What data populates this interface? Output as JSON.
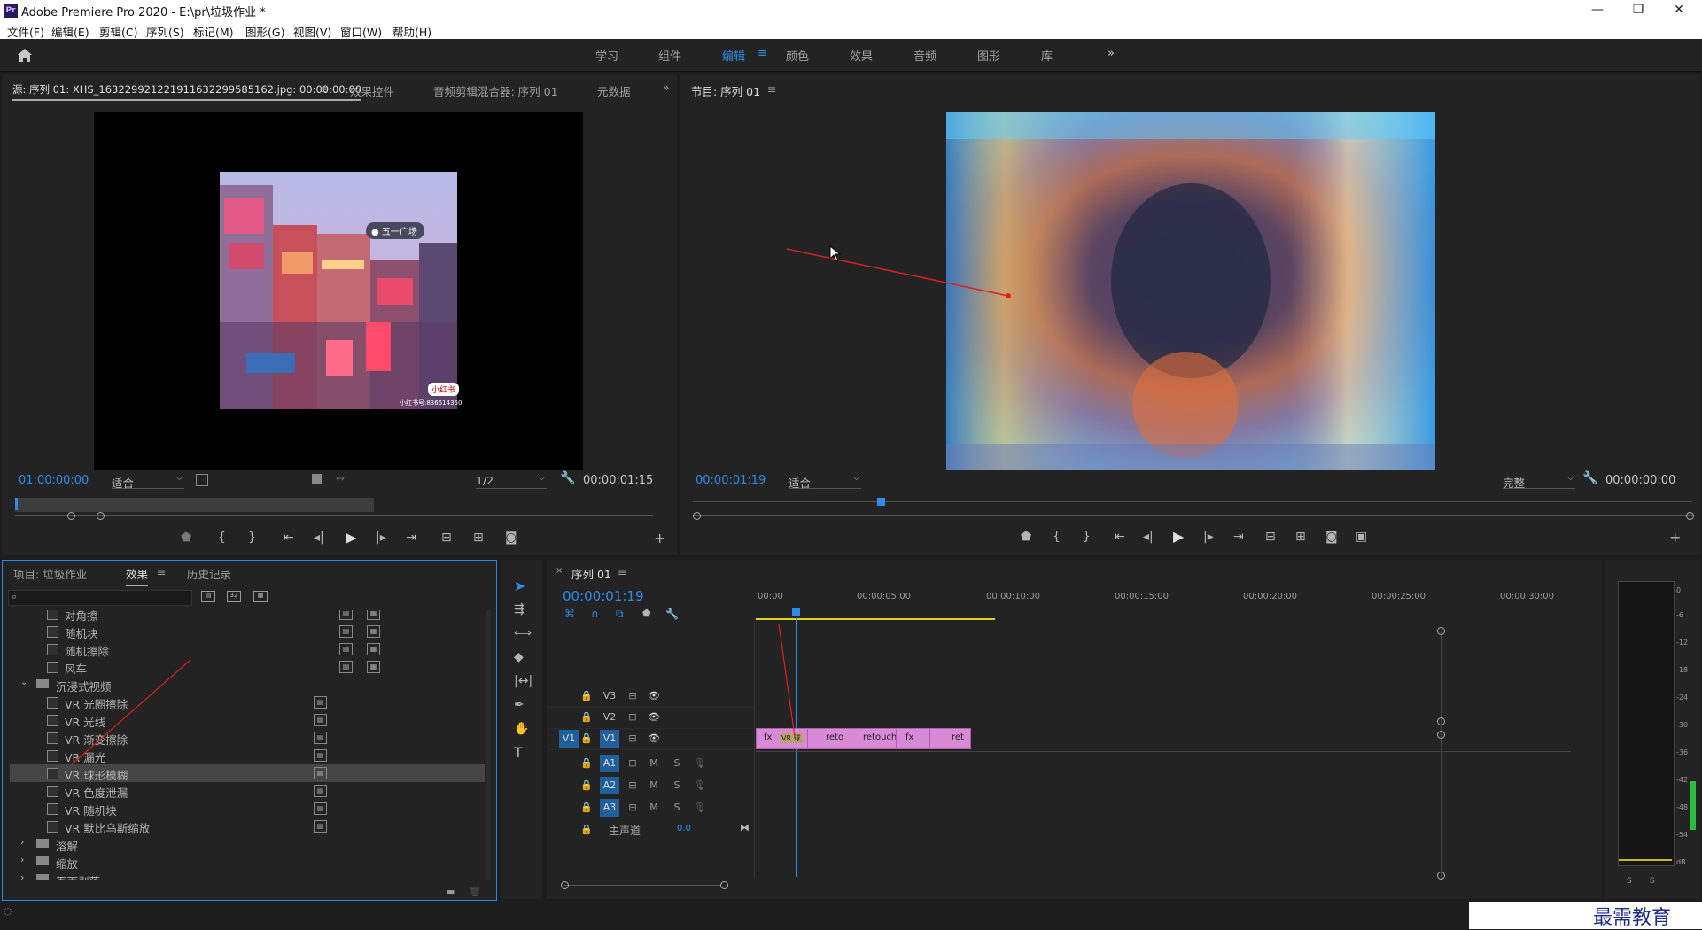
{
  "window": {
    "title": "Adobe Premiere Pro 2020 - E:\\pr\\垃圾作业 *",
    "logo": "Pr",
    "minimize": "—",
    "restore": "❐",
    "close": "✕"
  },
  "menu": [
    "文件(F)",
    "编辑(E)",
    "剪辑(C)",
    "序列(S)",
    "标记(M)",
    "图形(G)",
    "视图(V)",
    "窗口(W)",
    "帮助(H)"
  ],
  "workspaces": [
    "学习",
    "组件",
    "编辑",
    "颜色",
    "效果",
    "音频",
    "图形",
    "库"
  ],
  "workspace_more": "»",
  "source_panel": {
    "tabs": [
      "源: 序列 01: XHS_16322992122191163229958516​2.jpg: 00:00:00:00",
      "效果控件",
      "音频剪辑混合器: 序列 01",
      "元数据"
    ],
    "timecode": "01:00:00:00",
    "fit": "适合",
    "resolution": "1/2",
    "duration": "00:00:01:15",
    "image_sign": "五一广场",
    "image_badge": "小红书",
    "image_footer": "小红书号:836514360"
  },
  "program_panel": {
    "tab": "节目: 序列 01",
    "timecode": "00:00:01:19",
    "fit": "适合",
    "quality": "完整",
    "duration": "00:00:00:00"
  },
  "project_panel": {
    "tabs": [
      "项目: 垃圾作业",
      "效果",
      "历史记录"
    ],
    "search_placeholder": "",
    "rows": [
      {
        "type": "effect",
        "label": "对角擦",
        "vr": false
      },
      {
        "type": "effect",
        "label": "随机块",
        "vr": false
      },
      {
        "type": "effect",
        "label": "随机擦除",
        "vr": false
      },
      {
        "type": "effect",
        "label": "风车",
        "vr": false
      },
      {
        "type": "folder",
        "label": "沉浸式视频",
        "open": true
      },
      {
        "type": "effect",
        "label": "VR 光圈擦除",
        "vr": true
      },
      {
        "type": "effect",
        "label": "VR 光线",
        "vr": true
      },
      {
        "type": "effect",
        "label": "VR 渐变擦除",
        "vr": true
      },
      {
        "type": "effect",
        "label": "VR 漏光",
        "vr": true
      },
      {
        "type": "effect",
        "label": "VR 球形模糊",
        "vr": true,
        "selected": true
      },
      {
        "type": "effect",
        "label": "VR 色度泄漏",
        "vr": true
      },
      {
        "type": "effect",
        "label": "VR 随机块",
        "vr": true
      },
      {
        "type": "effect",
        "label": "VR 默比乌斯缩放",
        "vr": true
      },
      {
        "type": "folder",
        "label": "溶解",
        "open": false
      },
      {
        "type": "folder",
        "label": "缩放",
        "open": false
      },
      {
        "type": "folder",
        "label": "页面剥落",
        "open": false
      }
    ]
  },
  "timeline": {
    "tab": "序列 01",
    "timecode": "00:00:01:19",
    "ruler": [
      "00:00",
      "00:00:05:00",
      "00:00:10:00",
      "00:00:15:00",
      "00:00:20:00",
      "00:00:25:00",
      "00:00:30:00"
    ],
    "video_tracks": [
      "V3",
      "V2",
      "V1"
    ],
    "audio_tracks": [
      "A1",
      "A2",
      "A3"
    ],
    "source_patch": "V1",
    "master": "主声道",
    "master_value": "0.0",
    "clips": [
      {
        "label": "fx",
        "sub": "VR 球"
      },
      {
        "label": "reto"
      },
      {
        "label": "retouch"
      },
      {
        "label": "fx"
      },
      {
        "label": "ret"
      }
    ],
    "m": "M",
    "s": "S"
  },
  "meter": {
    "scale": [
      "0",
      "-6",
      "-12",
      "-18",
      "-24",
      "-30",
      "-36",
      "-42",
      "-48",
      "-54",
      "dB"
    ],
    "solo": [
      "S",
      "S"
    ]
  },
  "watermark": "最需教育"
}
